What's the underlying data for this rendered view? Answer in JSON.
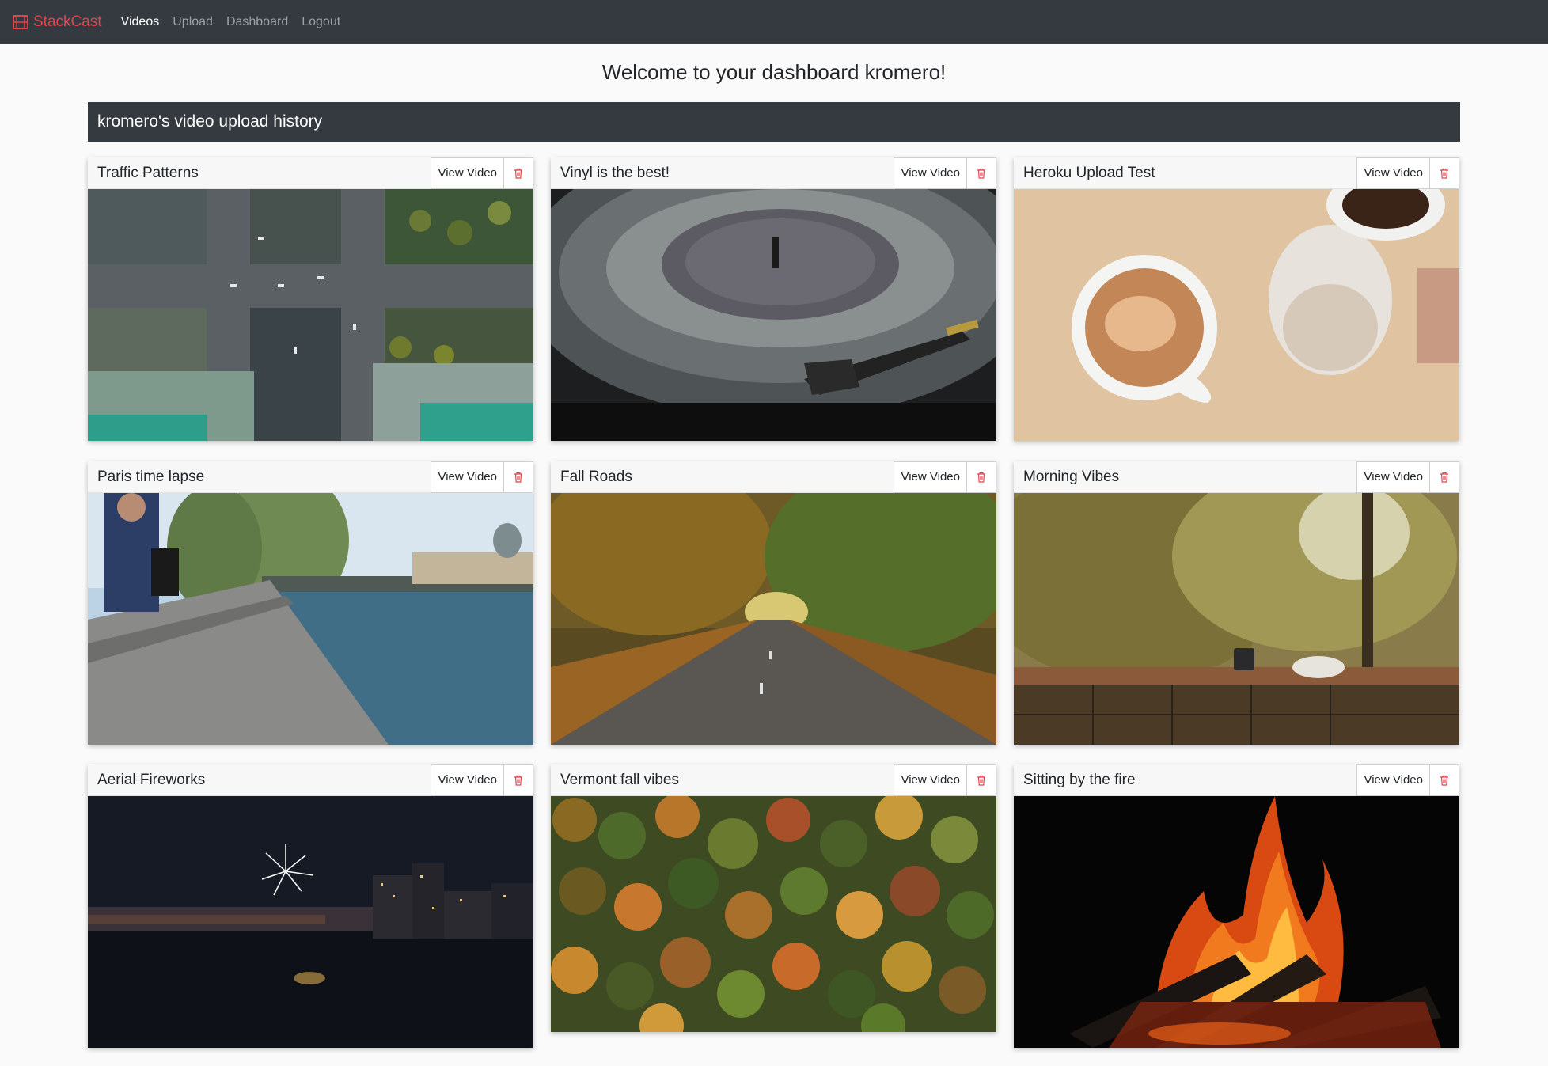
{
  "nav": {
    "brand": "StackCast",
    "links": [
      "Videos",
      "Upload",
      "Dashboard",
      "Logout"
    ],
    "active": "Videos"
  },
  "welcome": "Welcome to your dashboard kromero!",
  "history_title": "kromero's video upload history",
  "view_label": "View Video",
  "colors": {
    "navbar": "#343a40",
    "brand": "#e4434b",
    "delete": "#e4434b"
  },
  "videos": [
    {
      "title": "Traffic Patterns"
    },
    {
      "title": "Vinyl is the best!"
    },
    {
      "title": "Heroku Upload Test"
    },
    {
      "title": "Paris time lapse"
    },
    {
      "title": "Fall Roads"
    },
    {
      "title": "Morning Vibes"
    },
    {
      "title": "Aerial Fireworks"
    },
    {
      "title": "Vermont fall vibes"
    },
    {
      "title": "Sitting by the fire"
    }
  ]
}
